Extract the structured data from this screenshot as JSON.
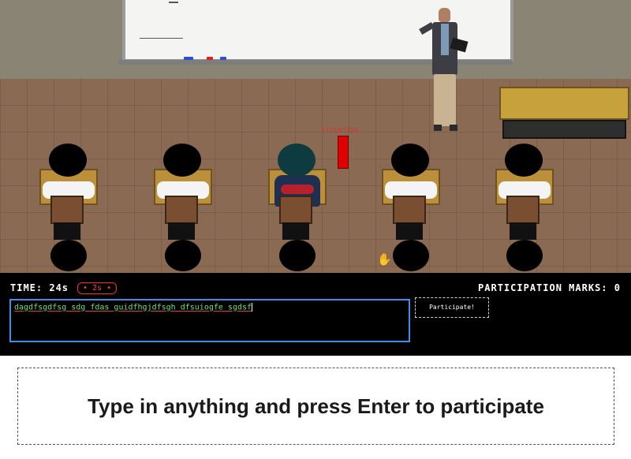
{
  "scene": {
    "attention_label": "ATTENTION",
    "attention_level": 1.0,
    "students": [
      {
        "id": "student-1",
        "player": false
      },
      {
        "id": "student-2",
        "player": false
      },
      {
        "id": "student-3",
        "player": true
      },
      {
        "id": "student-4",
        "player": false
      },
      {
        "id": "student-5",
        "player": false
      }
    ],
    "colors": {
      "attention": "#e00000",
      "wall": "#8a8475",
      "floor": "#8a6a52"
    }
  },
  "hud": {
    "timer_label": "TIME:",
    "timer_value": "24s",
    "timer_badge": "• 2s •",
    "marks_label": "PARTICIPATION MARKS:",
    "marks_value": "0",
    "input_value": "dagdfsgdfsg sdg fdas guidfhgjdfsgh dfsuiogfe sgdsf",
    "button_label": "Participate!",
    "colors": {
      "input_text": "#74e26b",
      "input_border": "#3f8fe8",
      "badge": "#ff2a2a"
    }
  },
  "instructions": {
    "text": "Type in anything and press Enter to participate"
  }
}
